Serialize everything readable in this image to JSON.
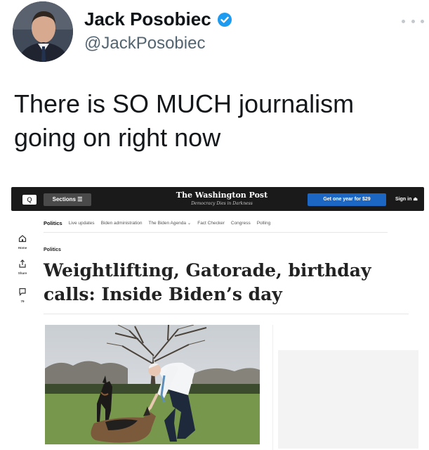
{
  "tweet": {
    "display_name": "Jack Posobiec",
    "handle": "@JackPosobiec",
    "text": "There is SO MUCH journalism going on right now",
    "verified_icon": "verified-badge-icon",
    "more_icon": "more-horizontal-icon",
    "accent_color": "#1d9bf0"
  },
  "embed": {
    "header": {
      "search_glyph": "Q",
      "sections_label": "Sections ☰",
      "logo": "The Washington Post",
      "tagline": "Democracy Dies in Darkness",
      "subscribe_label": "Get one year for $29",
      "signin_label": "Sign in ⏏"
    },
    "nav": {
      "items": [
        "Politics",
        "Live updates",
        "Biden administration",
        "The Biden Agenda ⌄",
        "Fact Checker",
        "Congress",
        "Polling"
      ]
    },
    "side": {
      "home_label": "Home",
      "share_label": "Share",
      "comments_count": "79"
    },
    "kicker": "Politics",
    "headline": "Weightlifting, Gatorade, birthday calls: Inside Biden’s day",
    "colors": {
      "header_bg": "#1a1a1a",
      "subscribe_bg": "#1b67c3"
    }
  }
}
